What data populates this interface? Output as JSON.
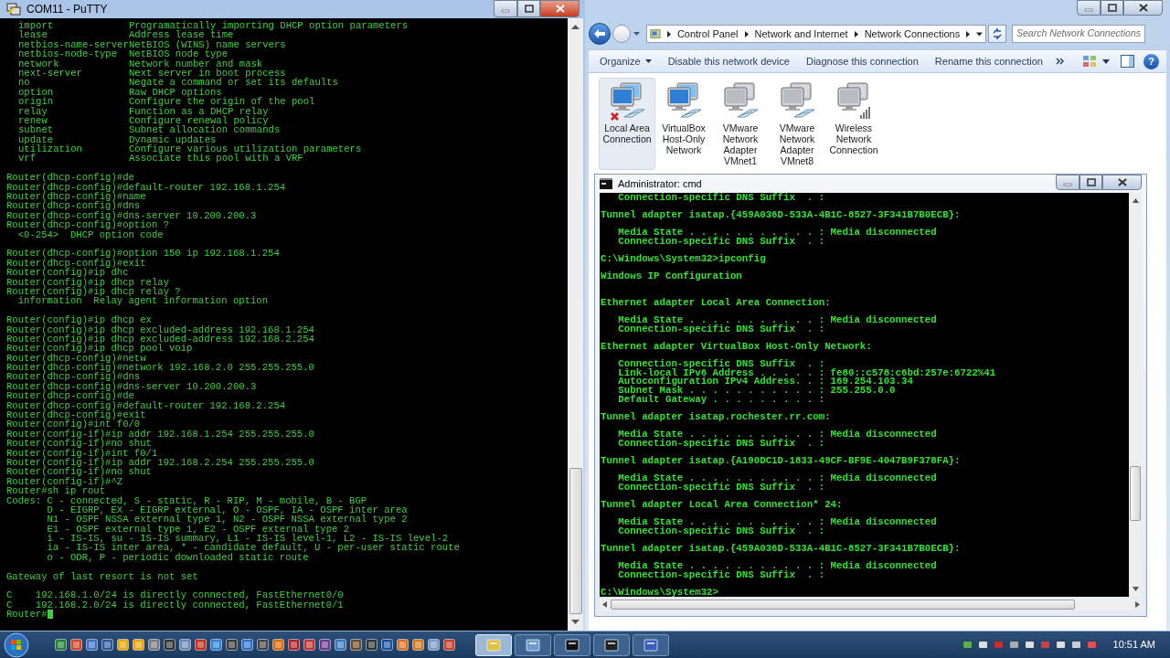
{
  "putty": {
    "title": "COM11 - PuTTY",
    "cursor": true,
    "blocks": [
      [
        {
          "kind": "help",
          "name": "import",
          "desc": "Programatically importing DHCP option parameters"
        },
        {
          "kind": "help",
          "name": "lease",
          "desc": "Address lease time"
        },
        {
          "kind": "help",
          "name": "netbios-name-server",
          "desc": "NetBIOS (WINS) name servers"
        },
        {
          "kind": "help",
          "name": "netbios-node-type",
          "desc": "NetBIOS node type"
        },
        {
          "kind": "help",
          "name": "network",
          "desc": "Network number and mask"
        },
        {
          "kind": "help",
          "name": "next-server",
          "desc": "Next server in boot process"
        },
        {
          "kind": "help",
          "name": "no",
          "desc": "Negate a command or set its defaults"
        },
        {
          "kind": "help",
          "name": "option",
          "desc": "Raw DHCP options"
        },
        {
          "kind": "help",
          "name": "origin",
          "desc": "Configure the origin of the pool"
        },
        {
          "kind": "help",
          "name": "relay",
          "desc": "Function as a DHCP relay"
        },
        {
          "kind": "help",
          "name": "renew",
          "desc": "Configure renewal policy"
        },
        {
          "kind": "help",
          "name": "subnet",
          "desc": "Subnet allocation commands"
        },
        {
          "kind": "help",
          "name": "update",
          "desc": "Dynamic updates"
        },
        {
          "kind": "help",
          "name": "utilization",
          "desc": "Configure various utilization parameters"
        },
        {
          "kind": "help",
          "name": "vrf",
          "desc": "Associate this pool with a VRF"
        }
      ],
      [
        {
          "kind": "text",
          "text": "Router(dhcp-config)#de"
        },
        {
          "kind": "text",
          "text": "Router(dhcp-config)#default-router 192.168.1.254"
        },
        {
          "kind": "text",
          "text": "Router(dhcp-config)#name"
        },
        {
          "kind": "text",
          "text": "Router(dhcp-config)#dns"
        },
        {
          "kind": "text",
          "text": "Router(dhcp-config)#dns-server 10.200.200.3"
        },
        {
          "kind": "text",
          "text": "Router(dhcp-config)#option ?"
        },
        {
          "kind": "text",
          "text": "  <0-254>  DHCP option code"
        }
      ],
      [
        {
          "kind": "text",
          "text": "Router(dhcp-config)#option 150 ip 192.168.1.254"
        },
        {
          "kind": "text",
          "text": "Router(dhcp-config)#exit"
        },
        {
          "kind": "text",
          "text": "Router(config)#ip dhc"
        },
        {
          "kind": "text",
          "text": "Router(config)#ip dhcp relay"
        },
        {
          "kind": "text",
          "text": "Router(config)#ip dhcp relay ?"
        },
        {
          "kind": "text",
          "text": "  information  Relay agent information option"
        }
      ],
      [
        {
          "kind": "text",
          "text": "Router(config)#ip dhcp ex"
        },
        {
          "kind": "text",
          "text": "Router(config)#ip dhcp excluded-address 192.168.1.254"
        },
        {
          "kind": "text",
          "text": "Router(config)#ip dhcp excluded-address 192.168.2.254"
        },
        {
          "kind": "text",
          "text": "Router(config)#ip dhcp pool voip"
        },
        {
          "kind": "text",
          "text": "Router(dhcp-config)#netw"
        },
        {
          "kind": "text",
          "text": "Router(dhcp-config)#network 192.168.2.0 255.255.255.0"
        },
        {
          "kind": "text",
          "text": "Router(dhcp-config)#dns"
        },
        {
          "kind": "text",
          "text": "Router(dhcp-config)#dns-server 10.200.200.3"
        },
        {
          "kind": "text",
          "text": "Router(dhcp-config)#de"
        },
        {
          "kind": "text",
          "text": "Router(dhcp-config)#default-router 192.168.2.254"
        },
        {
          "kind": "text",
          "text": "Router(dhcp-config)#exit"
        },
        {
          "kind": "text",
          "text": "Router(config)#int f0/0"
        },
        {
          "kind": "text",
          "text": "Router(config-if)#ip addr 192.168.1.254 255.255.255.0"
        },
        {
          "kind": "text",
          "text": "Router(config-if)#no shut"
        },
        {
          "kind": "text",
          "text": "Router(config-if)#int f0/1"
        },
        {
          "kind": "text",
          "text": "Router(config-if)#ip addr 192.168.2.254 255.255.255.0"
        },
        {
          "kind": "text",
          "text": "Router(config-if)#no shut"
        },
        {
          "kind": "text",
          "text": "Router(config-if)#^Z"
        },
        {
          "kind": "text",
          "text": "Router#sh ip rout"
        },
        {
          "kind": "text",
          "text": "Codes: C - connected, S - static, R - RIP, M - mobile, B - BGP"
        },
        {
          "kind": "text",
          "text": "       D - EIGRP, EX - EIGRP external, O - OSPF, IA - OSPF inter area"
        },
        {
          "kind": "text",
          "text": "       N1 - OSPF NSSA external type 1, N2 - OSPF NSSA external type 2"
        },
        {
          "kind": "text",
          "text": "       E1 - OSPF external type 1, E2 - OSPF external type 2"
        },
        {
          "kind": "text",
          "text": "       i - IS-IS, su - IS-IS summary, L1 - IS-IS level-1, L2 - IS-IS level-2"
        },
        {
          "kind": "text",
          "text": "       ia - IS-IS inter area, * - candidate default, U - per-user static route"
        },
        {
          "kind": "text",
          "text": "       o - ODR, P - periodic downloaded static route"
        }
      ],
      [
        {
          "kind": "text",
          "text": "Gateway of last resort is not set"
        }
      ],
      [
        {
          "kind": "text",
          "text": "C    192.168.1.0/24 is directly connected, FastEthernet0/0"
        },
        {
          "kind": "text",
          "text": "C    192.168.2.0/24 is directly connected, FastEthernet0/1"
        },
        {
          "kind": "text",
          "text": "Router#"
        }
      ]
    ]
  },
  "explorer": {
    "breadcrumb": [
      "Control Panel",
      "Network and Internet",
      "Network Connections"
    ],
    "search": {
      "placeholder": "Search Network Connections"
    },
    "commands": [
      {
        "label": "Organize",
        "dropdown": true
      },
      {
        "label": "Disable this network device",
        "dropdown": false
      },
      {
        "label": "Diagnose this connection",
        "dropdown": false
      },
      {
        "label": "Rename this connection",
        "dropdown": false
      }
    ],
    "help_glyph": "?",
    "connections": [
      {
        "label": "Local Area Connection",
        "kind": "wired",
        "selected": true,
        "disconnected": true,
        "disabled": false
      },
      {
        "label": "VirtualBox Host-Only Network",
        "kind": "wired",
        "selected": false,
        "disconnected": false,
        "disabled": false
      },
      {
        "label": "VMware Network Adapter VMnet1",
        "kind": "wired",
        "selected": false,
        "disconnected": false,
        "disabled": true
      },
      {
        "label": "VMware Network Adapter VMnet8",
        "kind": "wired",
        "selected": false,
        "disconnected": false,
        "disabled": true
      },
      {
        "label": "Wireless Network Connection",
        "kind": "wireless",
        "selected": false,
        "disconnected": false,
        "disabled": true
      }
    ]
  },
  "cmd": {
    "title": "Administrator: cmd",
    "blocks": [
      {
        "lines": [
          "   Connection-specific DNS Suffix  . :"
        ]
      },
      {
        "lines": [
          "Tunnel adapter isatap.{459A036D-533A-4B1C-8527-3F341B7B0ECB}:"
        ]
      },
      {
        "lines": [
          "   Media State . . . . . . . . . . . : Media disconnected",
          "   Connection-specific DNS Suffix  . :"
        ]
      },
      {
        "lines": [
          "C:\\Windows\\System32>ipconfig"
        ]
      },
      {
        "lines": [
          "Windows IP Configuration"
        ]
      },
      {
        "lines": [
          "Ethernet adapter Local Area Connection:"
        ],
        "extra_gap": true
      },
      {
        "lines": [
          "   Media State . . . . . . . . . . . : Media disconnected",
          "   Connection-specific DNS Suffix  . :"
        ]
      },
      {
        "lines": [
          "Ethernet adapter VirtualBox Host-Only Network:"
        ]
      },
      {
        "lines": [
          "   Connection-specific DNS Suffix  . :",
          "   Link-local IPv6 Address . . . . . : fe80::c578:c6bd:257e:6722%41",
          "   Autoconfiguration IPv4 Address. . : 169.254.103.34",
          "   Subnet Mask . . . . . . . . . . . : 255.255.0.0",
          "   Default Gateway . . . . . . . . . :"
        ]
      },
      {
        "lines": [
          "Tunnel adapter isatap.rochester.rr.com:"
        ]
      },
      {
        "lines": [
          "   Media State . . . . . . . . . . . : Media disconnected",
          "   Connection-specific DNS Suffix  . :"
        ]
      },
      {
        "lines": [
          "Tunnel adapter isatap.{A190DC1D-1833-49CF-BF9E-4047B9F378FA}:"
        ]
      },
      {
        "lines": [
          "   Media State . . . . . . . . . . . : Media disconnected",
          "   Connection-specific DNS Suffix  . :"
        ]
      },
      {
        "lines": [
          "Tunnel adapter Local Area Connection* 24:"
        ]
      },
      {
        "lines": [
          "   Media State . . . . . . . . . . . : Media disconnected",
          "   Connection-specific DNS Suffix  . :"
        ]
      },
      {
        "lines": [
          "Tunnel adapter isatap.{459A036D-533A-4B1C-8527-3F341B7B0ECB}:"
        ]
      },
      {
        "lines": [
          "   Media State . . . . . . . . . . . : Media disconnected",
          "   Connection-specific DNS Suffix  . :"
        ]
      },
      {
        "lines": [
          "C:\\Windows\\System32>"
        ]
      }
    ]
  },
  "taskbar": {
    "windows": [
      {
        "selected": true
      },
      {
        "selected": false
      },
      {
        "selected": false
      },
      {
        "selected": false
      },
      {
        "selected": false
      }
    ],
    "clock": "10:51 AM"
  }
}
